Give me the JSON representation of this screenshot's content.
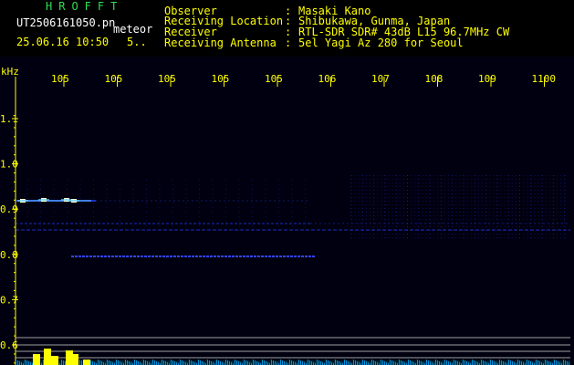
{
  "header": {
    "app_title": "HROFFT",
    "file_name": "UT2506161050.pn",
    "meteor_label": "meteor",
    "datetime": "25.06.16 10:50",
    "count": "5.."
  },
  "info": [
    {
      "label": "Observer",
      "sep": ":",
      "value": "Masaki Kano"
    },
    {
      "label": "Receiving Location",
      "sep": ":",
      "value": "Shibukawa, Gunma, Japan"
    },
    {
      "label": "Receiver",
      "sep": ":",
      "value": "RTL-SDR SDR# 43dB L15 96.7MHz CW"
    },
    {
      "label": "Receiving Antenna",
      "sep": ":",
      "value": "5el Yagi Az 280 for Seoul"
    }
  ],
  "plot": {
    "y_unit": "kHz",
    "y_ticks": [
      "1.1",
      "1.0",
      "0.9",
      "0.8",
      "0.7",
      "0.6"
    ],
    "x_ticks": [
      "105",
      "105",
      "105",
      "105",
      "105",
      "106",
      "107",
      "108",
      "109",
      "1100"
    ],
    "colors": {
      "axis": "#ffff00",
      "trace_blue": "#2233dd",
      "trace_bright": "#66ccff",
      "echo": "#ffffcc",
      "baseline": "#00aaff",
      "level_lines": "#bbbbbb"
    }
  }
}
